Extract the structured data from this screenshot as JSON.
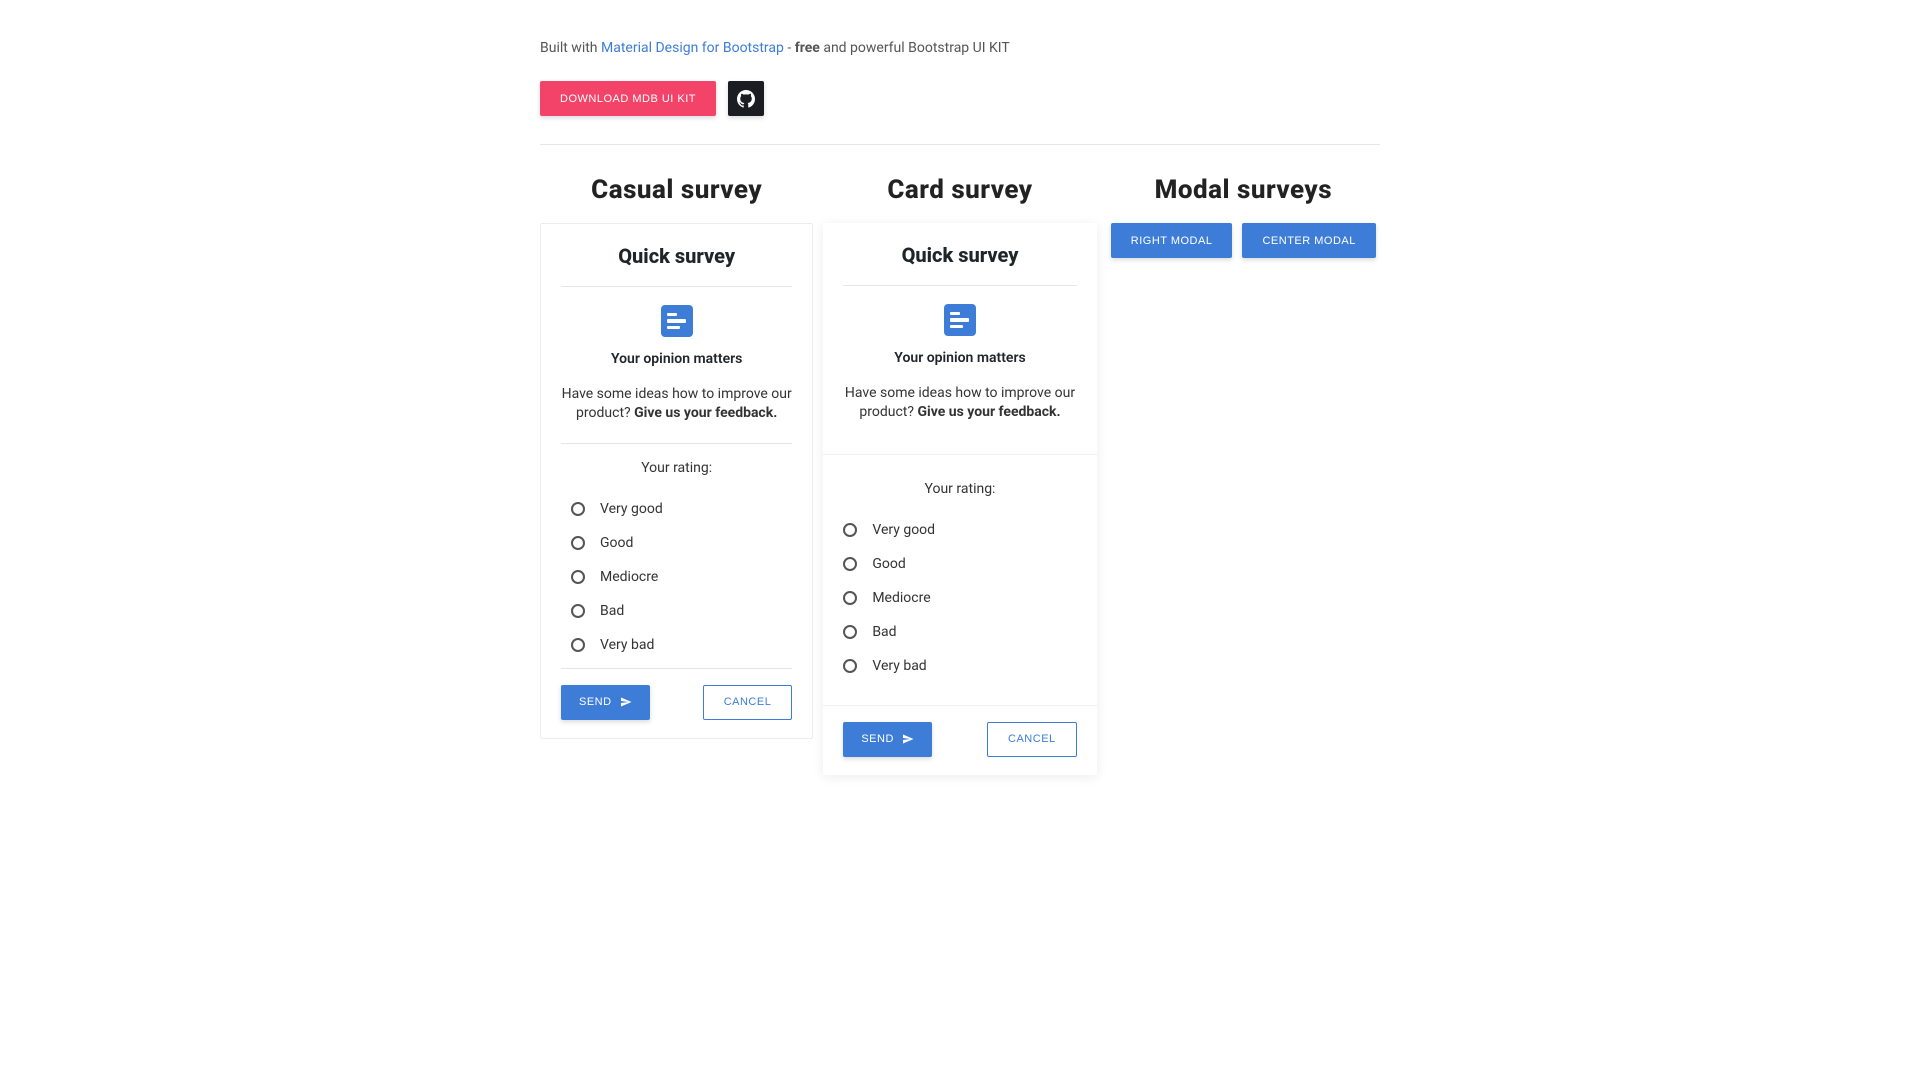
{
  "header": {
    "prefix": "Built with ",
    "link": "Material Design for Bootstrap",
    "middle": " - ",
    "strong1": "free",
    "suffix": " and powerful Bootstrap UI KIT",
    "download": "DOWNLOAD MDB UI KIT"
  },
  "col1": {
    "title": "Casual survey",
    "card_title": "Quick survey",
    "subtitle": "Your opinion matters",
    "desc_text": "Have some ideas how to improve our product?",
    "desc_strong": "Give us your feedback.",
    "rating_label": "Your rating:",
    "options": [
      "Very good",
      "Good",
      "Mediocre",
      "Bad",
      "Very bad"
    ],
    "send": "SEND",
    "cancel": "CANCEL"
  },
  "col2": {
    "title": "Card survey",
    "card_title": "Quick survey",
    "subtitle": "Your opinion matters",
    "desc_text": "Have some ideas how to improve our product?",
    "desc_strong": "Give us your feedback.",
    "rating_label": "Your rating:",
    "options": [
      "Very good",
      "Good",
      "Mediocre",
      "Bad",
      "Very bad"
    ],
    "send": "SEND",
    "cancel": "CANCEL"
  },
  "col3": {
    "title": "Modal surveys",
    "btn1": "RIGHT MODAL",
    "btn2": "CENTER MODAL"
  }
}
